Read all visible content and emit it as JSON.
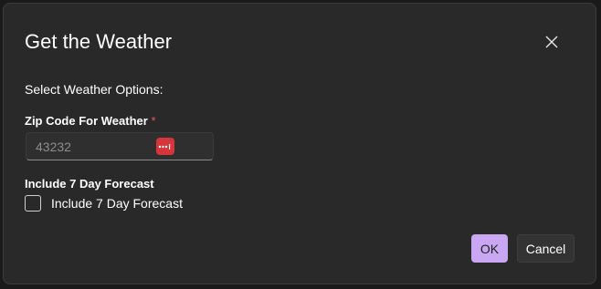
{
  "dialog": {
    "title": "Get the Weather",
    "subtitle": "Select Weather Options:",
    "zip_field": {
      "label": "Zip Code For Weather",
      "required_marker": "*",
      "placeholder": "43232",
      "value": ""
    },
    "forecast_section": {
      "label": "Include 7 Day Forecast",
      "checkbox_label": "Include 7 Day Forecast",
      "checked": false
    },
    "buttons": {
      "ok_label": "OK",
      "cancel_label": "Cancel"
    }
  },
  "colors": {
    "background": "#292929",
    "accent": "#c9a7f2",
    "required": "#e05a5a",
    "password_icon": "#d6363b"
  },
  "icons": {
    "close": "close-icon",
    "password_manager": "password-manager-icon"
  }
}
